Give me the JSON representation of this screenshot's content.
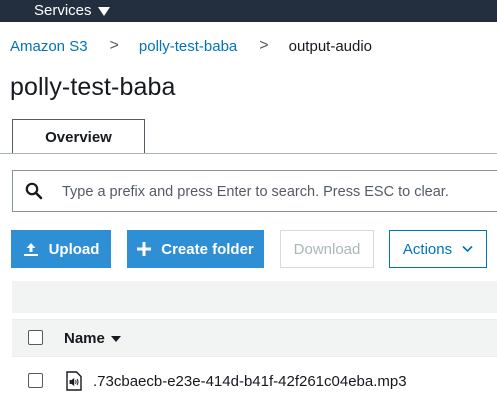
{
  "topbar": {
    "services_label": "Services"
  },
  "breadcrumb": {
    "items": [
      {
        "label": "Amazon S3"
      },
      {
        "label": "polly-test-baba"
      },
      {
        "label": "output-audio"
      }
    ],
    "separator": ">"
  },
  "page": {
    "title": "polly-test-baba"
  },
  "tabs": [
    {
      "label": "Overview",
      "active": true
    }
  ],
  "search": {
    "placeholder": "Type a prefix and press Enter to search. Press ESC to clear.",
    "value": ""
  },
  "toolbar": {
    "upload_label": "Upload",
    "create_folder_label": "Create folder",
    "download_label": "Download",
    "actions_label": "Actions"
  },
  "table": {
    "columns": [
      {
        "label": "Name",
        "sort": "descending"
      }
    ],
    "rows": [
      {
        "name": ".73cbaecb-e23e-414d-b41f-42f261c04eba.mp3",
        "icon": "audio-file-icon"
      }
    ]
  },
  "colors": {
    "topbar": "#232f3e",
    "link": "#0073bb",
    "primary_button": "#2e8fd4",
    "disabled_text": "#aab7b8"
  }
}
